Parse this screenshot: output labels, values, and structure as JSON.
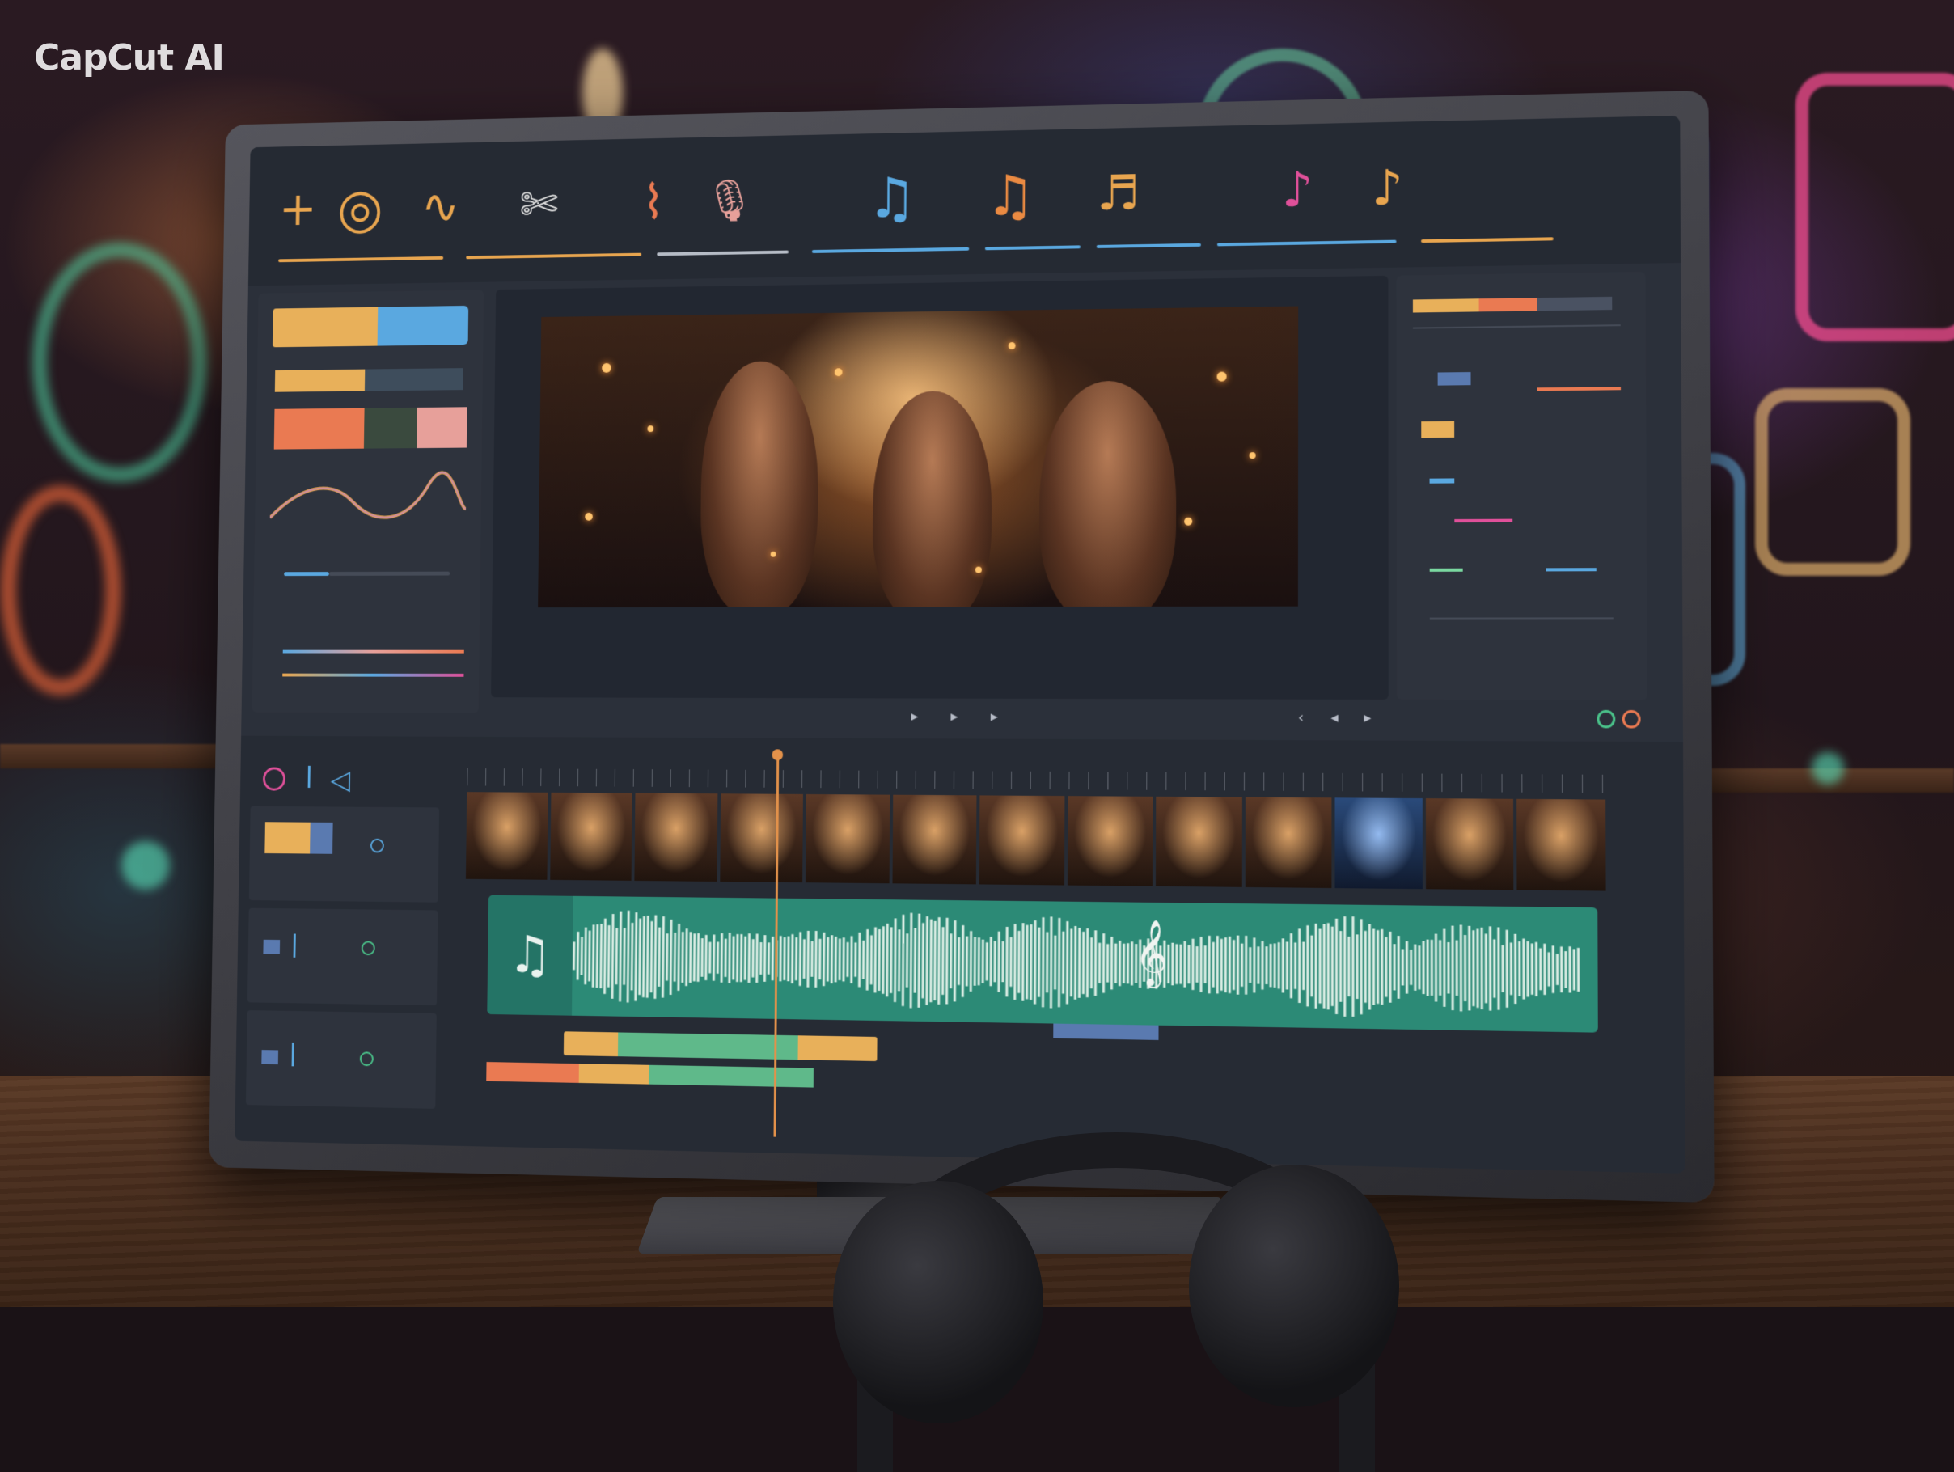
{
  "brand": {
    "logo_text": "CapCut AI"
  },
  "toolbar": {
    "icons": [
      {
        "name": "add-icon",
        "glyph": "+"
      },
      {
        "name": "film-reel-icon",
        "glyph": "◎"
      },
      {
        "name": "waveform-icon",
        "glyph": "∿"
      },
      {
        "name": "scissors-icon",
        "glyph": "✄"
      },
      {
        "name": "pulse-icon",
        "glyph": "⌇"
      },
      {
        "name": "microphone-icon",
        "glyph": "🎙"
      },
      {
        "name": "music-note-blue-icon",
        "glyph": "♫"
      },
      {
        "name": "music-note-orange-icon",
        "glyph": "♫"
      },
      {
        "name": "music-note-sheet-icon",
        "glyph": "♬"
      },
      {
        "name": "music-note-pink-icon",
        "glyph": "♪"
      },
      {
        "name": "music-note-small-icon",
        "glyph": "♪"
      }
    ]
  },
  "timeline": {
    "audio_icon": "♫",
    "clef_icon": "𝄞",
    "track_controls": [
      "record-icon",
      "split-icon",
      "play-back-icon"
    ]
  },
  "colors": {
    "accent_orange": "#e8a54f",
    "accent_blue": "#5aa8e0",
    "accent_coral": "#ea7a52",
    "accent_pink": "#e7a09a",
    "audio_green": "#2c8a76",
    "playhead": "#e2914a"
  }
}
